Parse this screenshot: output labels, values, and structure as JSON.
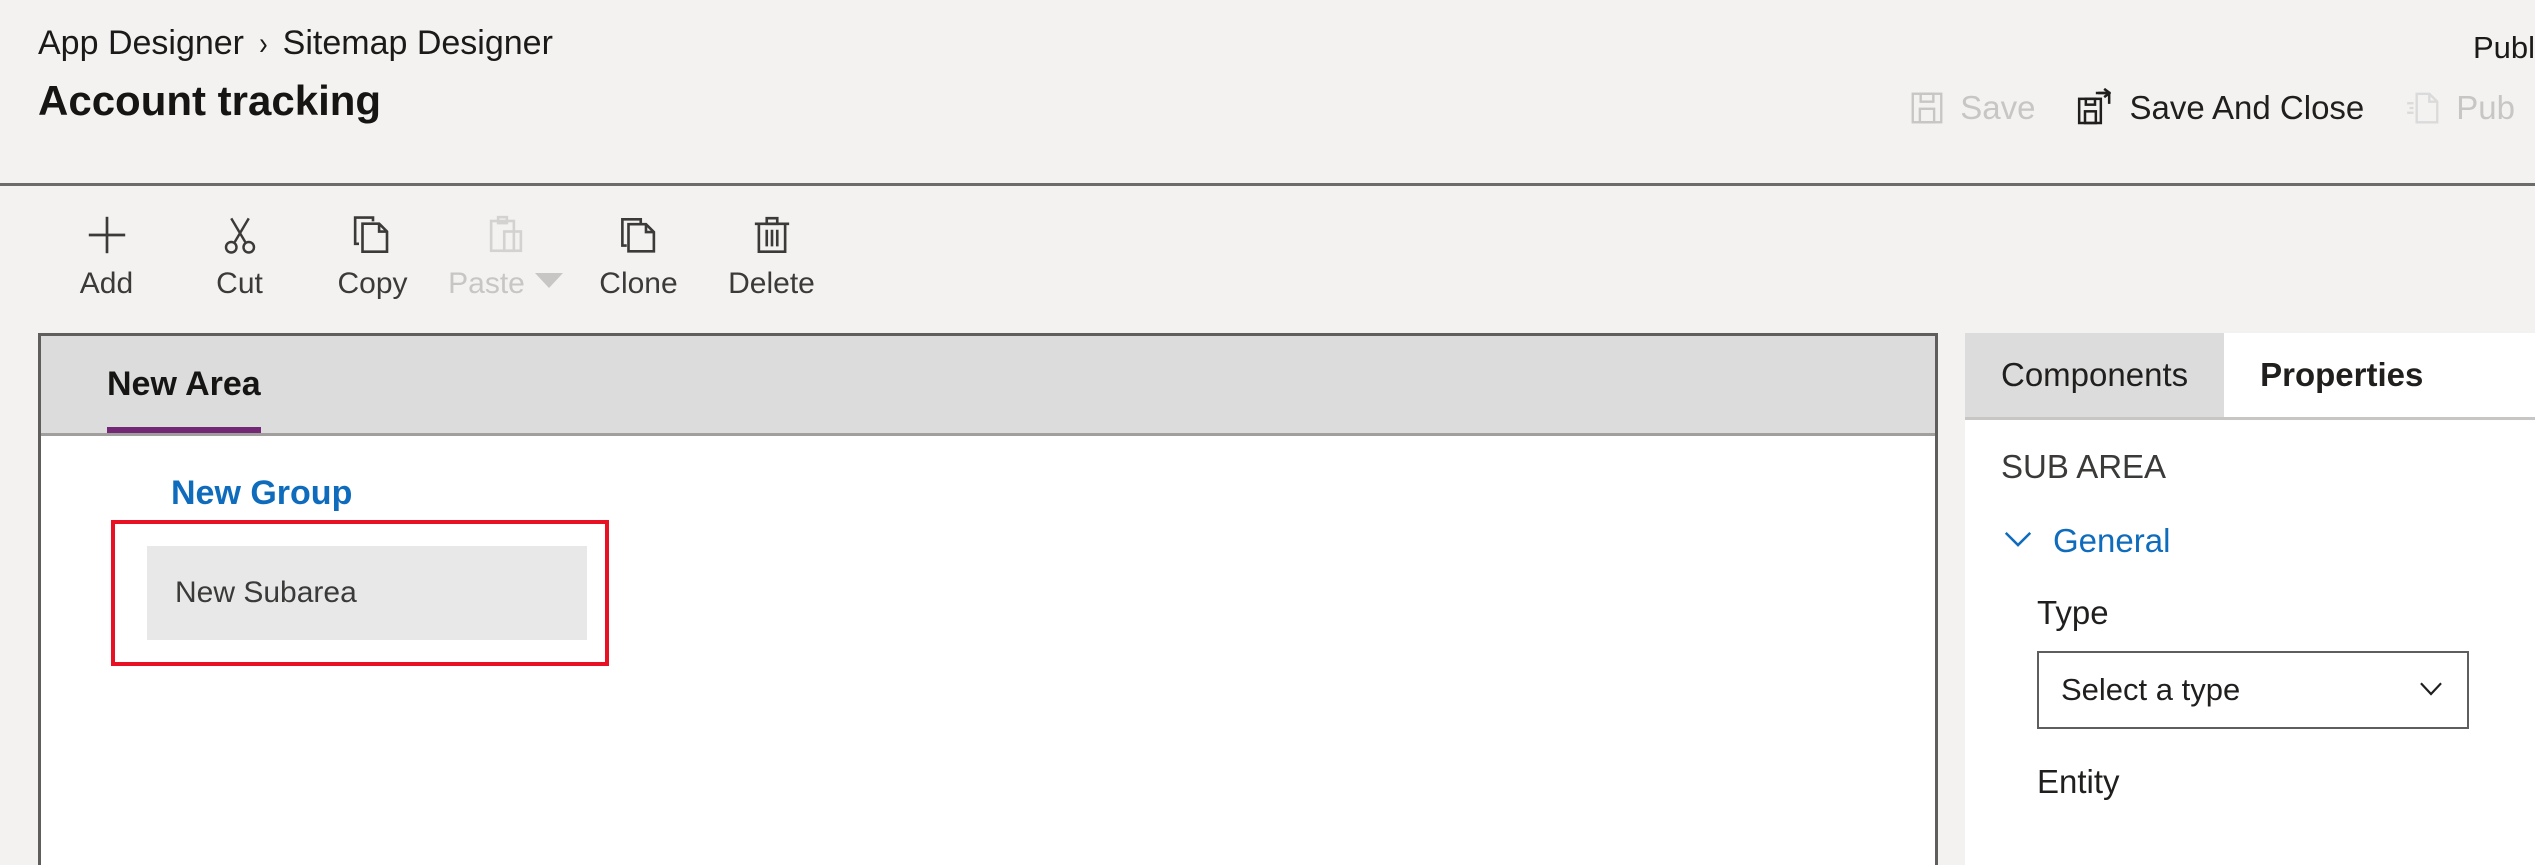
{
  "header": {
    "breadcrumb": [
      {
        "label": "App Designer"
      },
      {
        "label": "Sitemap Designer"
      }
    ],
    "separator": "›",
    "title": "Account tracking",
    "publish_note": "Publ",
    "commands": [
      {
        "label": "Save",
        "icon": "save-icon",
        "disabled": true
      },
      {
        "label": "Save And Close",
        "icon": "save-and-close-icon",
        "disabled": false
      },
      {
        "label": "Pub",
        "icon": "publish-icon",
        "disabled": true
      }
    ]
  },
  "toolbar": {
    "buttons": [
      {
        "label": "Add",
        "icon": "plus-icon",
        "disabled": false,
        "has_caret": false
      },
      {
        "label": "Cut",
        "icon": "scissors-icon",
        "disabled": false,
        "has_caret": false
      },
      {
        "label": "Copy",
        "icon": "copy-icon",
        "disabled": false,
        "has_caret": false
      },
      {
        "label": "Paste",
        "icon": "clipboard-icon",
        "disabled": true,
        "has_caret": true
      },
      {
        "label": "Clone",
        "icon": "clone-icon",
        "disabled": false,
        "has_caret": false
      },
      {
        "label": "Delete",
        "icon": "trash-icon",
        "disabled": false,
        "has_caret": false
      }
    ]
  },
  "canvas": {
    "area_tabs": [
      {
        "label": "New Area",
        "active": true
      }
    ],
    "group": {
      "label": "New Group",
      "subareas": [
        {
          "label": "New Subarea",
          "selected": true
        }
      ]
    }
  },
  "panel": {
    "tabs": [
      {
        "label": "Components",
        "active": false
      },
      {
        "label": "Properties",
        "active": true
      }
    ],
    "section_title": "SUB AREA",
    "group_label": "General",
    "group_expanded": true,
    "fields": [
      {
        "label": "Type",
        "control": "select",
        "value": "Select a type"
      },
      {
        "label": "Entity",
        "control": "none",
        "value": ""
      }
    ]
  },
  "colors": {
    "accent_purple": "#742774",
    "link_blue": "#0f6cbd",
    "selection_red": "#e81123",
    "chrome_gray": "#f3f2f1",
    "tab_gray": "#dcdcdc",
    "chip_gray": "#e8e8e8"
  }
}
